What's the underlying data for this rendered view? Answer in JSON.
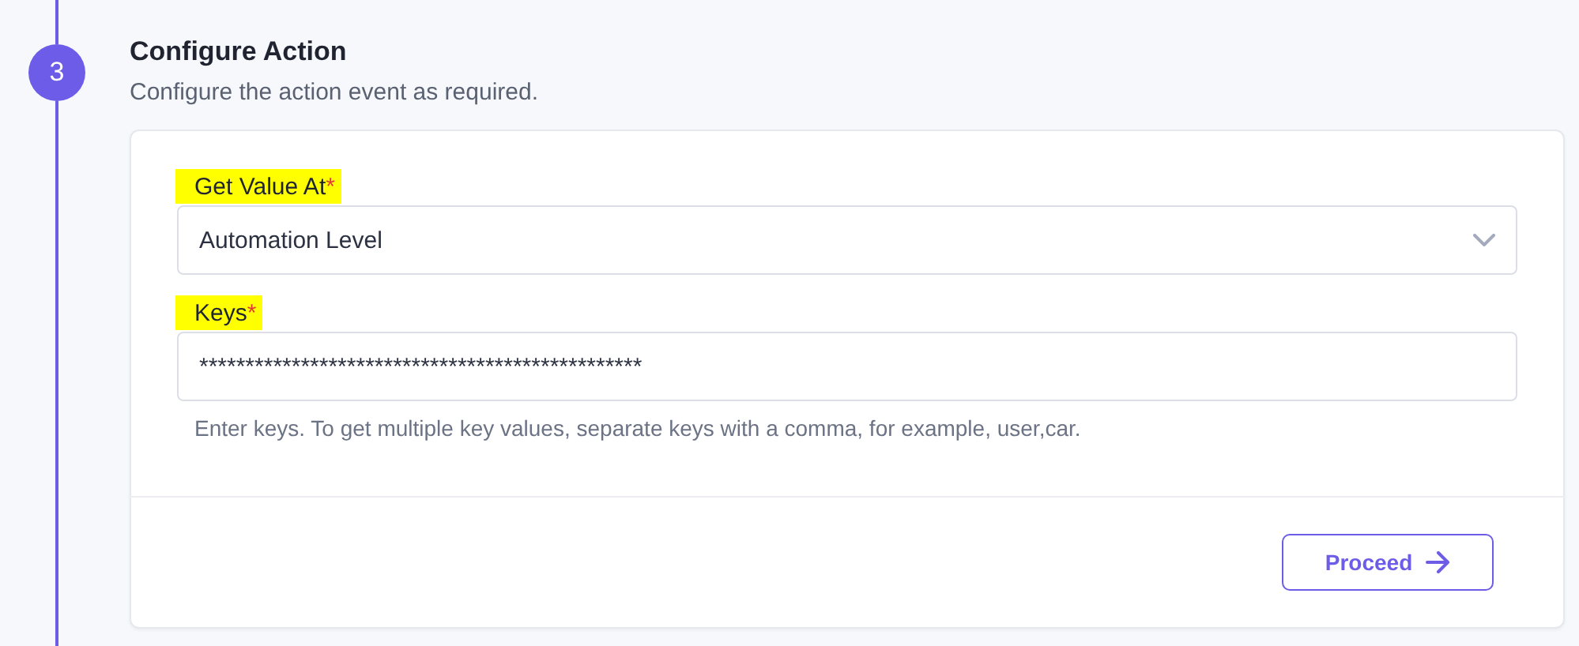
{
  "step": {
    "number": "3",
    "title": "Configure Action",
    "subtitle": "Configure the action event as required."
  },
  "fields": [
    {
      "kind": "select",
      "label": "Get Value At",
      "required_mark": "*",
      "highlighted": true,
      "value": "Automation Level"
    },
    {
      "kind": "text",
      "label": "Keys",
      "required_mark": "*",
      "highlighted": true,
      "value": "************************************************",
      "hint": "Enter keys. To get multiple key values, separate keys with a comma, for example, user,car."
    }
  ],
  "buttons": [
    {
      "label": "Proceed"
    }
  ]
}
